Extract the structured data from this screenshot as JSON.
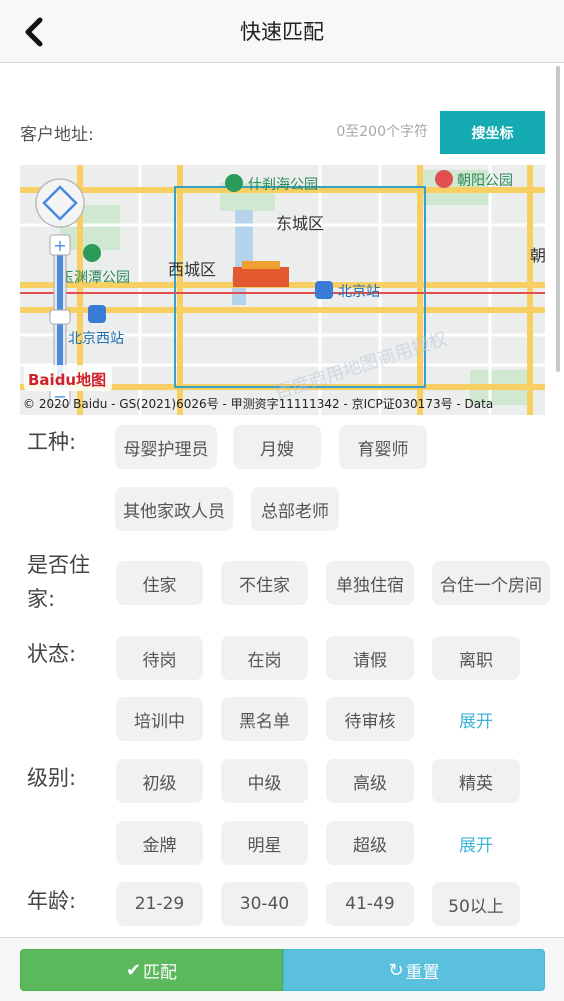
{
  "header": {
    "title": "快速匹配"
  },
  "address": {
    "label": "客户地址:",
    "placeholder": "0至200个字符",
    "search_button": "搜坐标"
  },
  "map": {
    "places": [
      "什刹海公园",
      "东城区",
      "西城区",
      "北京站",
      "北京西站",
      "朝阳公园",
      "玉渊潭公园",
      "朝"
    ],
    "copyright": "© 2020 Baidu - GS(2021)6026号 - 甲测资字11111342 - 京ICP证030173号 - Data",
    "logo": "Baidu地图",
    "watermark": "百度商用地图商用授权",
    "zoom_in": "+",
    "zoom_out": "−"
  },
  "filters": {
    "job_type": {
      "label": "工种:",
      "options": [
        "母婴护理员",
        "月嫂",
        "育婴师",
        "其他家政人员",
        "总部老师"
      ]
    },
    "live_in": {
      "label": "是否住家:",
      "options": [
        "住家",
        "不住家",
        "单独住宿",
        "合住一个房间"
      ]
    },
    "status": {
      "label": "状态:",
      "options": [
        "待岗",
        "在岗",
        "请假",
        "离职",
        "培训中",
        "黑名单",
        "待审核"
      ],
      "expand": "展开"
    },
    "level": {
      "label": "级别:",
      "options": [
        "初级",
        "中级",
        "高级",
        "精英",
        "金牌",
        "明星",
        "超级"
      ],
      "expand": "展开"
    },
    "age": {
      "label": "年龄:",
      "options": [
        "21-29",
        "30-40",
        "41-49",
        "50以上"
      ]
    }
  },
  "footer": {
    "match": "匹配",
    "reset": "重置"
  },
  "colors": {
    "teal": "#14aab1",
    "green": "#5cb85c",
    "blue": "#5bc0de",
    "link": "#3fb4d8"
  }
}
